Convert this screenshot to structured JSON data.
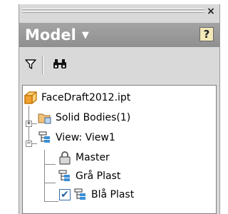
{
  "panel": {
    "title": "Model",
    "title_caret": "▼",
    "close_glyph": "×",
    "help_glyph": "?",
    "help_icon": "help-icon",
    "filter_icon": "filter-icon",
    "find_icon": "binoculars-icon"
  },
  "tree": {
    "root": {
      "label": "FaceDraft2012.ipt",
      "icon": "part-icon"
    },
    "solid_bodies": {
      "label": "Solid Bodies(1)",
      "icon": "folder-bodies-icon",
      "expander": "+"
    },
    "view": {
      "label": "View: View1",
      "icon": "view-rep-icon",
      "expander": "−"
    },
    "children": [
      {
        "label": "Master",
        "icon": "lock-icon",
        "checked": false
      },
      {
        "label": "Grå Plast",
        "icon": "view-rep-icon",
        "checked": false
      },
      {
        "label": "Blå Plast",
        "icon": "view-rep-icon",
        "checked": true,
        "check_glyph": "✔"
      }
    ]
  },
  "colors": {
    "panel_bg": "#d9d9d9",
    "titlebar": "#999999",
    "part_orange": "#f0a030",
    "check_blue": "#2563a8"
  }
}
